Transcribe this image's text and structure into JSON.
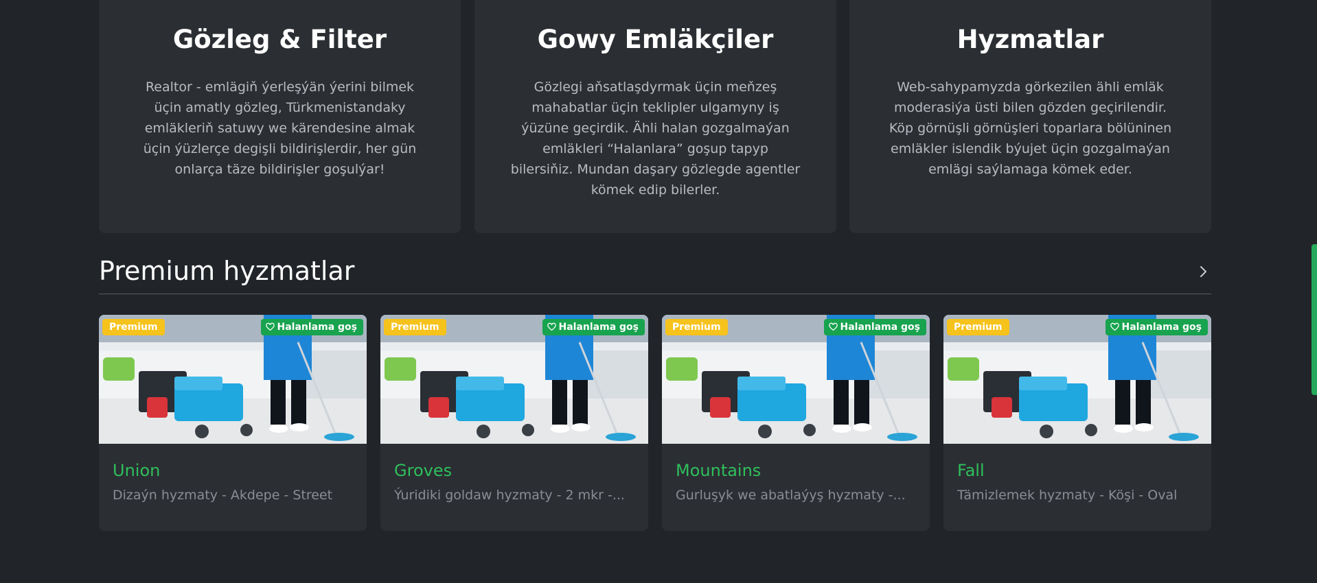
{
  "features": [
    {
      "title": "Gözleg & Filter",
      "text": "Realtor - emlägiň ýerleşýän ýerini bilmek üçin amatly gözleg, Türkmenistandaky emläkleriň satuwy we kärendesine almak üçin ýüzlerçe degişli bildirişlerdir, her gün onlarça täze bildirişler goşulýar!"
    },
    {
      "title": "Gowy Emläkçiler",
      "text": "Gözlegi aňsatlaşdyrmak üçin meňzeş mahabatlar üçin teklipler ulgamyny iş ýüzüne geçirdik. Ähli halan gozgalmaýan emläkleri “Halanlara” goşup tapyp bilersiňiz. Mundan daşary gözlegde agentler kömek edip bilerler."
    },
    {
      "title": "Hyzmatlar",
      "text": "Web-sahypamyzda görkezilen ähli emläk moderasiýa üsti bilen gözden geçirilendir. Köp görnüşli görnüşleri toparlara bölüninen emläkler islendik býujet üçin gozgalmaýan emlägi saýlamaga kömek eder."
    }
  ],
  "premium": {
    "title": "Premium hyzmatlar",
    "arrow_icon": "chevron-right-icon",
    "cards": [
      {
        "badge": "Premium",
        "fav_label": "Halanlama goş",
        "title": "Union",
        "subtitle": "Dizaýn hyzmaty - Akdepe - Street"
      },
      {
        "badge": "Premium",
        "fav_label": "Halanlama goş",
        "title": "Groves",
        "subtitle": "Ýuridiki goldaw hyzmaty - 2 mkr -..."
      },
      {
        "badge": "Premium",
        "fav_label": "Halanlama goş",
        "title": "Mountains",
        "subtitle": "Gurluşyk we abatlaýyş hyzmaty -..."
      },
      {
        "badge": "Premium",
        "fav_label": "Halanlama goş",
        "title": "Fall",
        "subtitle": "Tämizlemek hyzmaty - Köşi - Oval"
      }
    ]
  },
  "colors": {
    "background": "#212429",
    "card": "#2b2e33",
    "accent_green": "#2fbf5c",
    "premium_yellow": "#f6c21c",
    "fav_green": "#18a34f"
  }
}
